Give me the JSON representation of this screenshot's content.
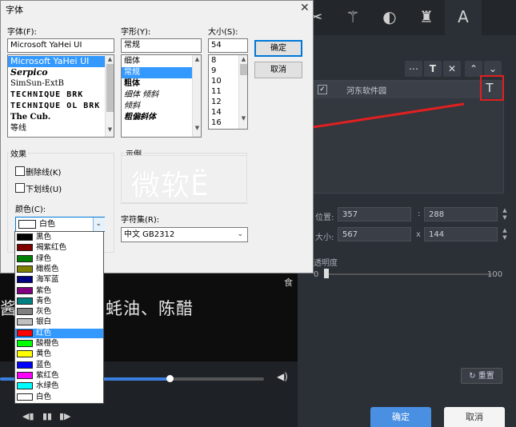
{
  "editor": {
    "video_subtitle": "酱油、生抽、蚝油、陈醋",
    "video_corner": "食",
    "layer_name": "河东软件园",
    "position_label": "位置:",
    "position_x": "357",
    "position_y": "288",
    "size_label": "大小:",
    "size_w": "567",
    "size_h": "144",
    "size_sep": "x",
    "pos_sep": ":",
    "opacity_label": "透明度",
    "opacity_min": "0",
    "opacity_max": "100",
    "reset_label": "重置",
    "ok_label": "确定",
    "cancel_label": "取消"
  },
  "dialog": {
    "title": "字体",
    "font_label": "字体(F):",
    "font_value": "Microsoft YaHei UI",
    "fonts": [
      "Microsoft YaHei UI",
      "Serpico",
      "SimSun-ExtB",
      "TECHNIQUE BRK",
      "TECHNIQUE OL BRK",
      "The Cub.",
      "等线"
    ],
    "style_label": "字形(Y):",
    "style_value": "常规",
    "styles": [
      "细体",
      "常规",
      "粗体",
      "细体 倾斜",
      "倾斜",
      "粗偏斜体"
    ],
    "size_label": "大小(S):",
    "size_value": "54",
    "sizes": [
      "8",
      "9",
      "10",
      "11",
      "12",
      "14",
      "16"
    ],
    "ok_label": "确定",
    "cancel_label": "取消",
    "effects_label": "效果",
    "strike_label": "删除线(K)",
    "underline_label": "下划线(U)",
    "color_label": "颜色(C):",
    "color_value": "白色",
    "sample_label": "示例",
    "sample_text": "微软Ё",
    "charset_label": "字符集(R):",
    "charset_value": "中文 GB2312",
    "colors": [
      {
        "name": "黑色",
        "hex": "#000000"
      },
      {
        "name": "褐紫红色",
        "hex": "#800000"
      },
      {
        "name": "绿色",
        "hex": "#008000"
      },
      {
        "name": "橄榄色",
        "hex": "#808000"
      },
      {
        "name": "海军蓝",
        "hex": "#000080"
      },
      {
        "name": "紫色",
        "hex": "#800080"
      },
      {
        "name": "青色",
        "hex": "#008080"
      },
      {
        "name": "灰色",
        "hex": "#808080"
      },
      {
        "name": "银白",
        "hex": "#c0c0c0"
      },
      {
        "name": "红色",
        "hex": "#ff0000"
      },
      {
        "name": "酸橙色",
        "hex": "#00ff00"
      },
      {
        "name": "黄色",
        "hex": "#ffff00"
      },
      {
        "name": "蓝色",
        "hex": "#0000ff"
      },
      {
        "name": "紫红色",
        "hex": "#ff00ff"
      },
      {
        "name": "水绿色",
        "hex": "#00ffff"
      },
      {
        "name": "白色",
        "hex": "#ffffff"
      }
    ],
    "selected_color_index": 9
  }
}
